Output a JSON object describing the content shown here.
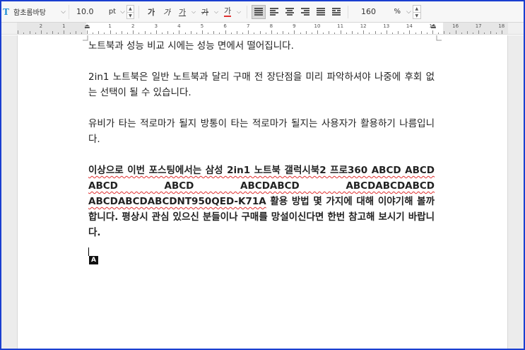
{
  "toolbar": {
    "font_name": "함초롬바탕",
    "font_size": "10.0",
    "font_unit": "pt",
    "format_buttons": [
      "가",
      "가",
      "가",
      "가",
      "가"
    ],
    "zoom_value": "160",
    "zoom_unit": "%"
  },
  "ruler": {
    "numbers": [
      "2",
      "1",
      "1",
      "2",
      "3",
      "4",
      "5",
      "6",
      "7",
      "8",
      "9",
      "10",
      "11",
      "12",
      "13",
      "14",
      "15",
      "16",
      "17",
      "18"
    ]
  },
  "document": {
    "line_1": "노트북과 성능 비교 시에는 성능 면에서 떨어집니다.",
    "para_2": "2in1 노트북은 일반 노트북과 달리 구매 전 장단점을 미리 파악하셔야 나중에 후회 없는 선택이 될 수 있습니다.",
    "para_3": "유비가 타는 적로마가 될지 방통이 타는 적로마가 될지는 사용자가 활용하기 나름입니다.",
    "para_4_a": "이상으로 이번 포스팅에서는 삼성 2in1 노트북 갤럭시북2 프로360 ABCD ABCD ABCD ABCD ABCDABCD ABCDABCDABCD ABCDABCDABCDNT950QED-K71A",
    "para_4_b": " 활용 방법 몇 가지에 대해 이야기해 볼까 합니다. 평상시 관심 있으신 분들이나 구매를 망설이신다면 한번 참고해 보시기 바랍니다.",
    "ime_indicator": "A"
  }
}
